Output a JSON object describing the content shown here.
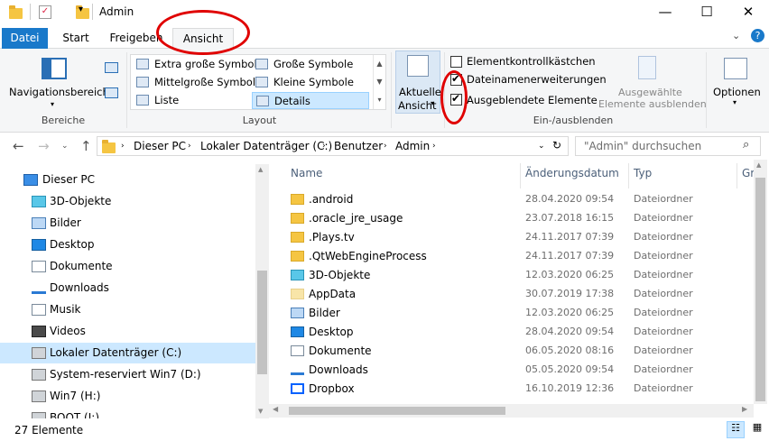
{
  "window": {
    "title": "Admin",
    "minimize": "—",
    "maximize": "☐",
    "close": "✕"
  },
  "tabs": [
    {
      "label": "Datei"
    },
    {
      "label": "Start"
    },
    {
      "label": "Freigeben"
    },
    {
      "label": "Ansicht"
    }
  ],
  "ribbon": {
    "bereiche": {
      "nav_label": "Navigationsbereich",
      "group": "Bereiche"
    },
    "layout": {
      "group": "Layout",
      "items": [
        "Extra große Symbole",
        "Große Symbole",
        "Mittelgroße Symbole",
        "Kleine Symbole",
        "Liste",
        "Details"
      ],
      "selected": "Details"
    },
    "current_view": {
      "line1": "Aktuelle",
      "line2": "Ansicht"
    },
    "show_hide": {
      "group": "Ein-/ausblenden",
      "checkboxes": [
        {
          "label": "Elementkontrollkästchen",
          "checked": false
        },
        {
          "label": "Dateinamenerweiterungen",
          "checked": true
        },
        {
          "label": "Ausgeblendete Elemente",
          "checked": true
        }
      ],
      "hide_selected_line1": "Ausgewählte",
      "hide_selected_line2": "Elemente ausblenden"
    },
    "options": {
      "label": "Optionen"
    }
  },
  "address": {
    "crumbs": [
      "Dieser PC",
      "Lokaler Datenträger (C:)",
      "Benutzer",
      "Admin"
    ],
    "search_placeholder": "\"Admin\" durchsuchen"
  },
  "tree": [
    {
      "label": "Dieser PC",
      "icon": "pc-icon"
    },
    {
      "label": "3D-Objekte",
      "icon": "3d-objects-icon"
    },
    {
      "label": "Bilder",
      "icon": "pictures-icon"
    },
    {
      "label": "Desktop",
      "icon": "desktop-icon"
    },
    {
      "label": "Dokumente",
      "icon": "documents-icon"
    },
    {
      "label": "Downloads",
      "icon": "downloads-icon"
    },
    {
      "label": "Musik",
      "icon": "music-icon"
    },
    {
      "label": "Videos",
      "icon": "videos-icon"
    },
    {
      "label": "Lokaler Datenträger (C:)",
      "icon": "drive-c-icon",
      "selected": true
    },
    {
      "label": "System-reserviert Win7 (D:)",
      "icon": "drive-icon"
    },
    {
      "label": "Win7 (H:)",
      "icon": "drive-icon"
    },
    {
      "label": "BOOT (I:)",
      "icon": "drive-icon"
    }
  ],
  "columns": {
    "name": "Name",
    "date": "Änderungsdatum",
    "type": "Typ",
    "size": "Gr"
  },
  "files": [
    {
      "name": ".android",
      "date": "28.04.2020 09:54",
      "type": "Dateiordner",
      "icon": "folder-icon"
    },
    {
      "name": ".oracle_jre_usage",
      "date": "23.07.2018 16:15",
      "type": "Dateiordner",
      "icon": "folder-icon"
    },
    {
      "name": ".Plays.tv",
      "date": "24.11.2017 07:39",
      "type": "Dateiordner",
      "icon": "folder-icon"
    },
    {
      "name": ".QtWebEngineProcess",
      "date": "24.11.2017 07:39",
      "type": "Dateiordner",
      "icon": "folder-icon"
    },
    {
      "name": "3D-Objekte",
      "date": "12.03.2020 06:25",
      "type": "Dateiordner",
      "icon": "3d-objects-icon"
    },
    {
      "name": "AppData",
      "date": "30.07.2019 17:38",
      "type": "Dateiordner",
      "icon": "folder-faded-icon"
    },
    {
      "name": "Bilder",
      "date": "12.03.2020 06:25",
      "type": "Dateiordner",
      "icon": "pictures-icon"
    },
    {
      "name": "Desktop",
      "date": "28.04.2020 09:54",
      "type": "Dateiordner",
      "icon": "desktop-icon"
    },
    {
      "name": "Dokumente",
      "date": "06.05.2020 08:16",
      "type": "Dateiordner",
      "icon": "documents-icon"
    },
    {
      "name": "Downloads",
      "date": "05.05.2020 09:54",
      "type": "Dateiordner",
      "icon": "downloads-icon"
    },
    {
      "name": "Dropbox",
      "date": "16.10.2019 12:36",
      "type": "Dateiordner",
      "icon": "dropbox-icon"
    }
  ],
  "status": {
    "count": "27 Elemente"
  },
  "colors": {
    "accent": "#1979ca",
    "selection": "#cce8ff",
    "annotation": "#e00000"
  }
}
